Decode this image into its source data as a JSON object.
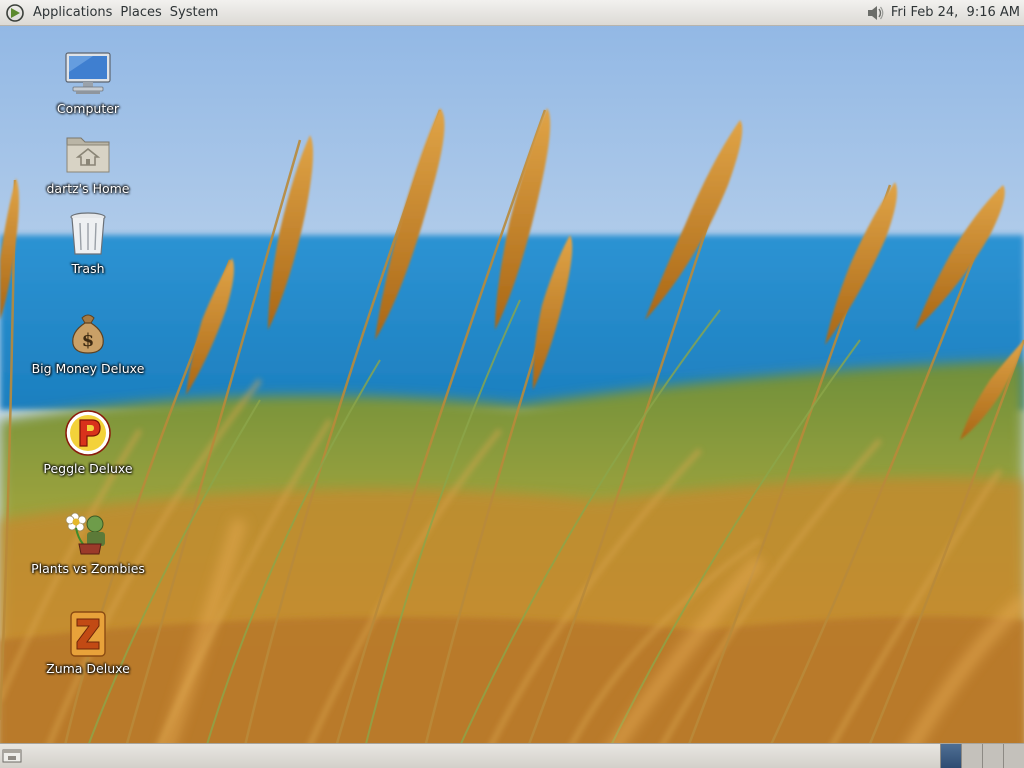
{
  "top_panel": {
    "menus": [
      "Applications",
      "Places",
      "System"
    ],
    "clock": "Fri Feb 24,  9:16 AM",
    "icons": {
      "logo": "debian-swirl-icon",
      "volume": "volume-speaker-icon"
    }
  },
  "desktop": {
    "wallpaper": "beach grass with blue sea",
    "icons": [
      {
        "label": "Computer",
        "icon": "computer-monitor-icon"
      },
      {
        "label": "dartz's Home",
        "icon": "home-folder-icon"
      },
      {
        "label": "Trash",
        "icon": "trash-can-icon"
      },
      {
        "label": "Big Money Deluxe",
        "icon": "money-bag-icon"
      },
      {
        "label": "Peggle Deluxe",
        "icon": "peggle-icon"
      },
      {
        "label": "Plants vs Zombies",
        "icon": "plants-vs-zombies-icon"
      },
      {
        "label": "Zuma Deluxe",
        "icon": "zuma-icon"
      }
    ]
  },
  "bottom_panel": {
    "icons": {
      "show_desktop": "show-desktop-icon"
    },
    "workspaces": [
      {
        "active": true
      },
      {
        "active": false
      },
      {
        "active": false
      },
      {
        "active": false
      }
    ]
  },
  "colors": {
    "panel_bg": "#dcdad5",
    "active_workspace": "#3b5b82",
    "sky": "#a9c6e6",
    "sea": "#2f8fcf",
    "grass": "#c98a2a"
  }
}
